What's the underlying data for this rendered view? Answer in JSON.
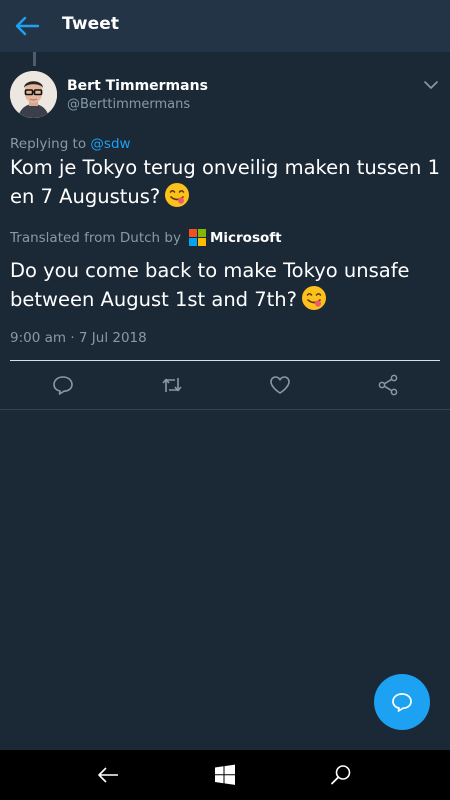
{
  "header": {
    "title": "Tweet"
  },
  "tweet": {
    "author_name": "Bert Timmermans",
    "author_handle": "@Berttimmermans",
    "replying_prefix": "Replying to ",
    "replying_to": "@sdw",
    "text": "Kom je Tokyo terug onveilig maken tussen 1 en 7 Augustus?",
    "translated_from": "Translated from Dutch by",
    "translator": "Microsoft",
    "translation": "Do you come back to make Tokyo unsafe between August 1st and 7th?",
    "timestamp": "9:00 am · 7 Jul 2018"
  },
  "icons": {
    "back": "back-arrow-icon",
    "chevron": "chevron-down-icon",
    "reply": "reply-icon",
    "retweet": "retweet-icon",
    "like": "like-heart-icon",
    "share": "share-icon",
    "compose": "compose-reply-icon",
    "nav_back": "nav-back-icon",
    "nav_home": "windows-logo-icon",
    "nav_search": "search-icon"
  },
  "colors": {
    "background": "#1b2836",
    "header": "#243447",
    "accent": "#1da1f2",
    "secondary_text": "#8899a6"
  }
}
